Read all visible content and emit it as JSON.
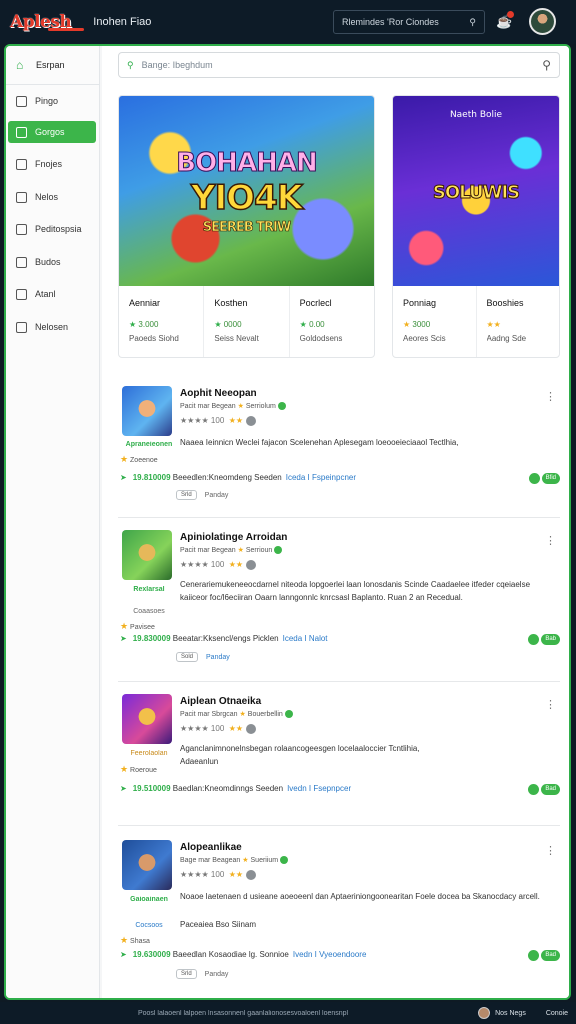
{
  "header": {
    "logo": "Aplesh",
    "app_title": "Inohen Fiao",
    "search_text": "Rlemindes  'Ror Ciondes",
    "notification_count": "1"
  },
  "sidebar": {
    "home": "Esrpan",
    "items": [
      {
        "label": "Pingo",
        "active": false
      },
      {
        "label": "Gorgos",
        "active": true
      },
      {
        "label": "Fnojes",
        "active": false
      },
      {
        "label": "Nelos",
        "active": false
      },
      {
        "label": "Peditospsia",
        "active": false
      },
      {
        "label": "Budos",
        "active": false
      },
      {
        "label": "Atanl",
        "active": false
      },
      {
        "label": "Nelosen",
        "active": false
      }
    ]
  },
  "main_search": {
    "placeholder": "Bange: Ibeghdum"
  },
  "featured": [
    {
      "title_line1": "BOHAHAN",
      "title_line2": "YIO4K",
      "title_line3": "SEEREB TRIW",
      "meta": [
        {
          "name": "Aenniar",
          "rating": "3.000",
          "note": "Paoeds Siohd"
        },
        {
          "name": "Kosthen",
          "rating": "0000",
          "note": "Seiss Nevalt"
        },
        {
          "name": "Pocrlecl",
          "rating": "0.00",
          "note": "Goldodsens"
        }
      ]
    },
    {
      "title_line1": "Naeth Bolie",
      "title_line2": "SOLUWIS",
      "meta": [
        {
          "name": "Ponniag",
          "rating": "3000",
          "note": "Aeores Scis"
        },
        {
          "name": "Booshies",
          "rating": "",
          "note": "Aadng Sde"
        }
      ]
    }
  ],
  "list": [
    {
      "title": "Aophit Neeopan",
      "sub": "Pacit mar Begean",
      "sub_right": "Serriolum",
      "stars_count": "100",
      "desc": "Naaea Ieinnicn Weclei fajacon Scelenehan Aplesegam loeooeieciaaol Tectlhia,",
      "under1": "Apraneieonen",
      "rate": "Zoeenoe",
      "version": "19.810009",
      "footer": "Beeedlen:Kneomdeng Seeden",
      "link": "Iceda I Fspeinpcner",
      "tag": "Bfid",
      "chip": "Srld",
      "chip_label": "Panday"
    },
    {
      "title": "Apiniolatinge Arroidan",
      "sub": "Pacit mar Begean",
      "sub_right": "Serrioun",
      "stars_count": "100",
      "desc": "Cenerariemukeneeocdarnel niteoda lopgoerlei laan lonosdanis Scinde Caadaelee itfeder cqeiaelse kaiiceor foc/l6eciiran Oaarn lanngonnlc knrcsasl Baplanto.  Ruan 2 an Recedual.",
      "under1": "Rexlarsal",
      "under2": "Coaasoes",
      "rate": "Pavisee",
      "version": "19.830009",
      "footer": "Beeatar:Kksencl/engs Picklen",
      "link": "Iceda I Nalot",
      "tag": "Bab",
      "chip": "Sold",
      "chip_label": "Panday"
    },
    {
      "title": "Aiplean Otnaeika",
      "sub": "Pacit mar Sbrgcan",
      "sub_right": "Bouerbellin",
      "stars_count": "100",
      "desc": "Aganclanimnonelnsbegan rolaancogeesgen locelaaloccier Tcntlihia,",
      "desc2": "Adaeanlun",
      "under1": "Feerolaolan",
      "rate": "Roeroue",
      "version": "19.510009",
      "footer": "Baedlan:Kneomdinngs Seeden",
      "link": "Ivedn I Fsepnpcer",
      "tag": "Bad"
    },
    {
      "title": "Alopeanlikae",
      "sub": "Bage mar Beagean",
      "sub_right": "Sueriium",
      "stars_count": "100",
      "desc": "Noaoe laetenaen d usieane aoeoeenl dan Aptaeriniongoonearitan Foele docea ba Skanocdacy arcell.",
      "desc2": "Paceaiea    Bso Siinam",
      "under1": "Gaioainaen",
      "under2": "Cocsoos",
      "rate": "Shasa",
      "version": "19.630009",
      "footer": "Baeedlan Kosaodiae lg. Sonnioe",
      "link": "Ivedn I Vyeoendoore",
      "tag": "Bad",
      "chip": "Srld",
      "chip_label": "Panday"
    }
  ],
  "statusbar": {
    "text": "Poosl lalaoenl lalpoen lnsasonnenl gaanlalionosesvoaloenl   loensnpl",
    "user": "Nos Negs",
    "extra": "Conoie"
  }
}
